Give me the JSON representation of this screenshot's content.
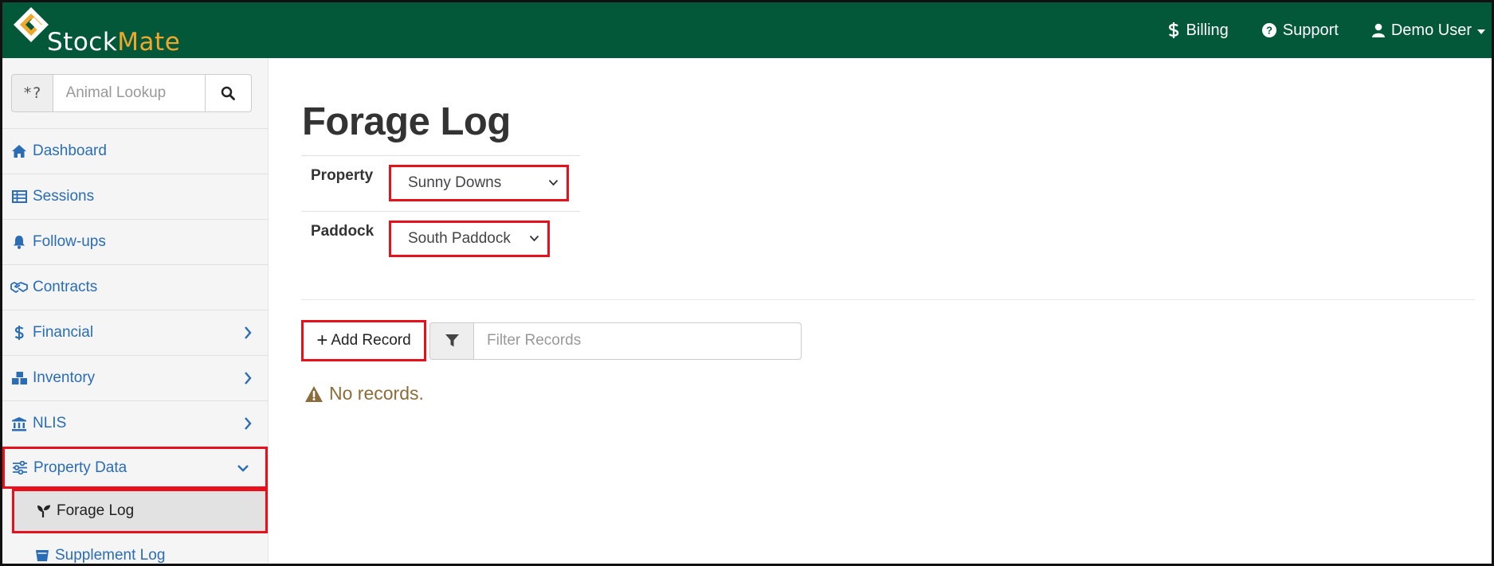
{
  "brand": {
    "name_part1": "Stock",
    "name_part2": "Mate"
  },
  "colors": {
    "navbar": "#025839",
    "brand_accent": "#f0a82c",
    "link": "#2a6db5",
    "highlight": "#e8101a",
    "warning_text": "#8a6d3b"
  },
  "navbar": {
    "billing": {
      "label": "Billing",
      "icon": "dollar-icon"
    },
    "support": {
      "label": "Support",
      "icon": "question-circle-icon"
    },
    "user": {
      "label": "Demo User",
      "icon": "user-icon"
    }
  },
  "sidebar": {
    "lookup": {
      "addon": "*?",
      "placeholder": "Animal Lookup",
      "value": ""
    },
    "items": [
      {
        "label": "Dashboard",
        "icon": "home-icon"
      },
      {
        "label": "Sessions",
        "icon": "table-icon"
      },
      {
        "label": "Follow-ups",
        "icon": "bell-icon"
      },
      {
        "label": "Contracts",
        "icon": "handshake-icon"
      },
      {
        "label": "Financial",
        "icon": "dollar-icon",
        "expandable": true
      },
      {
        "label": "Inventory",
        "icon": "boxes-icon",
        "expandable": true
      },
      {
        "label": "NLIS",
        "icon": "bank-icon",
        "expandable": true
      },
      {
        "label": "Property Data",
        "icon": "sliders-icon",
        "expandable": true,
        "expanded": true
      }
    ],
    "subitems": [
      {
        "label": "Forage Log",
        "icon": "seedling-icon",
        "current": true
      },
      {
        "label": "Supplement Log",
        "icon": "trough-icon"
      }
    ]
  },
  "main": {
    "title": "Forage Log",
    "filters": {
      "property": {
        "label": "Property",
        "selected": "Sunny Downs"
      },
      "paddock": {
        "label": "Paddock",
        "selected": "South Paddock"
      }
    },
    "add_record_label": "Add Record",
    "filter_placeholder": "Filter Records",
    "empty_message": "No records."
  }
}
